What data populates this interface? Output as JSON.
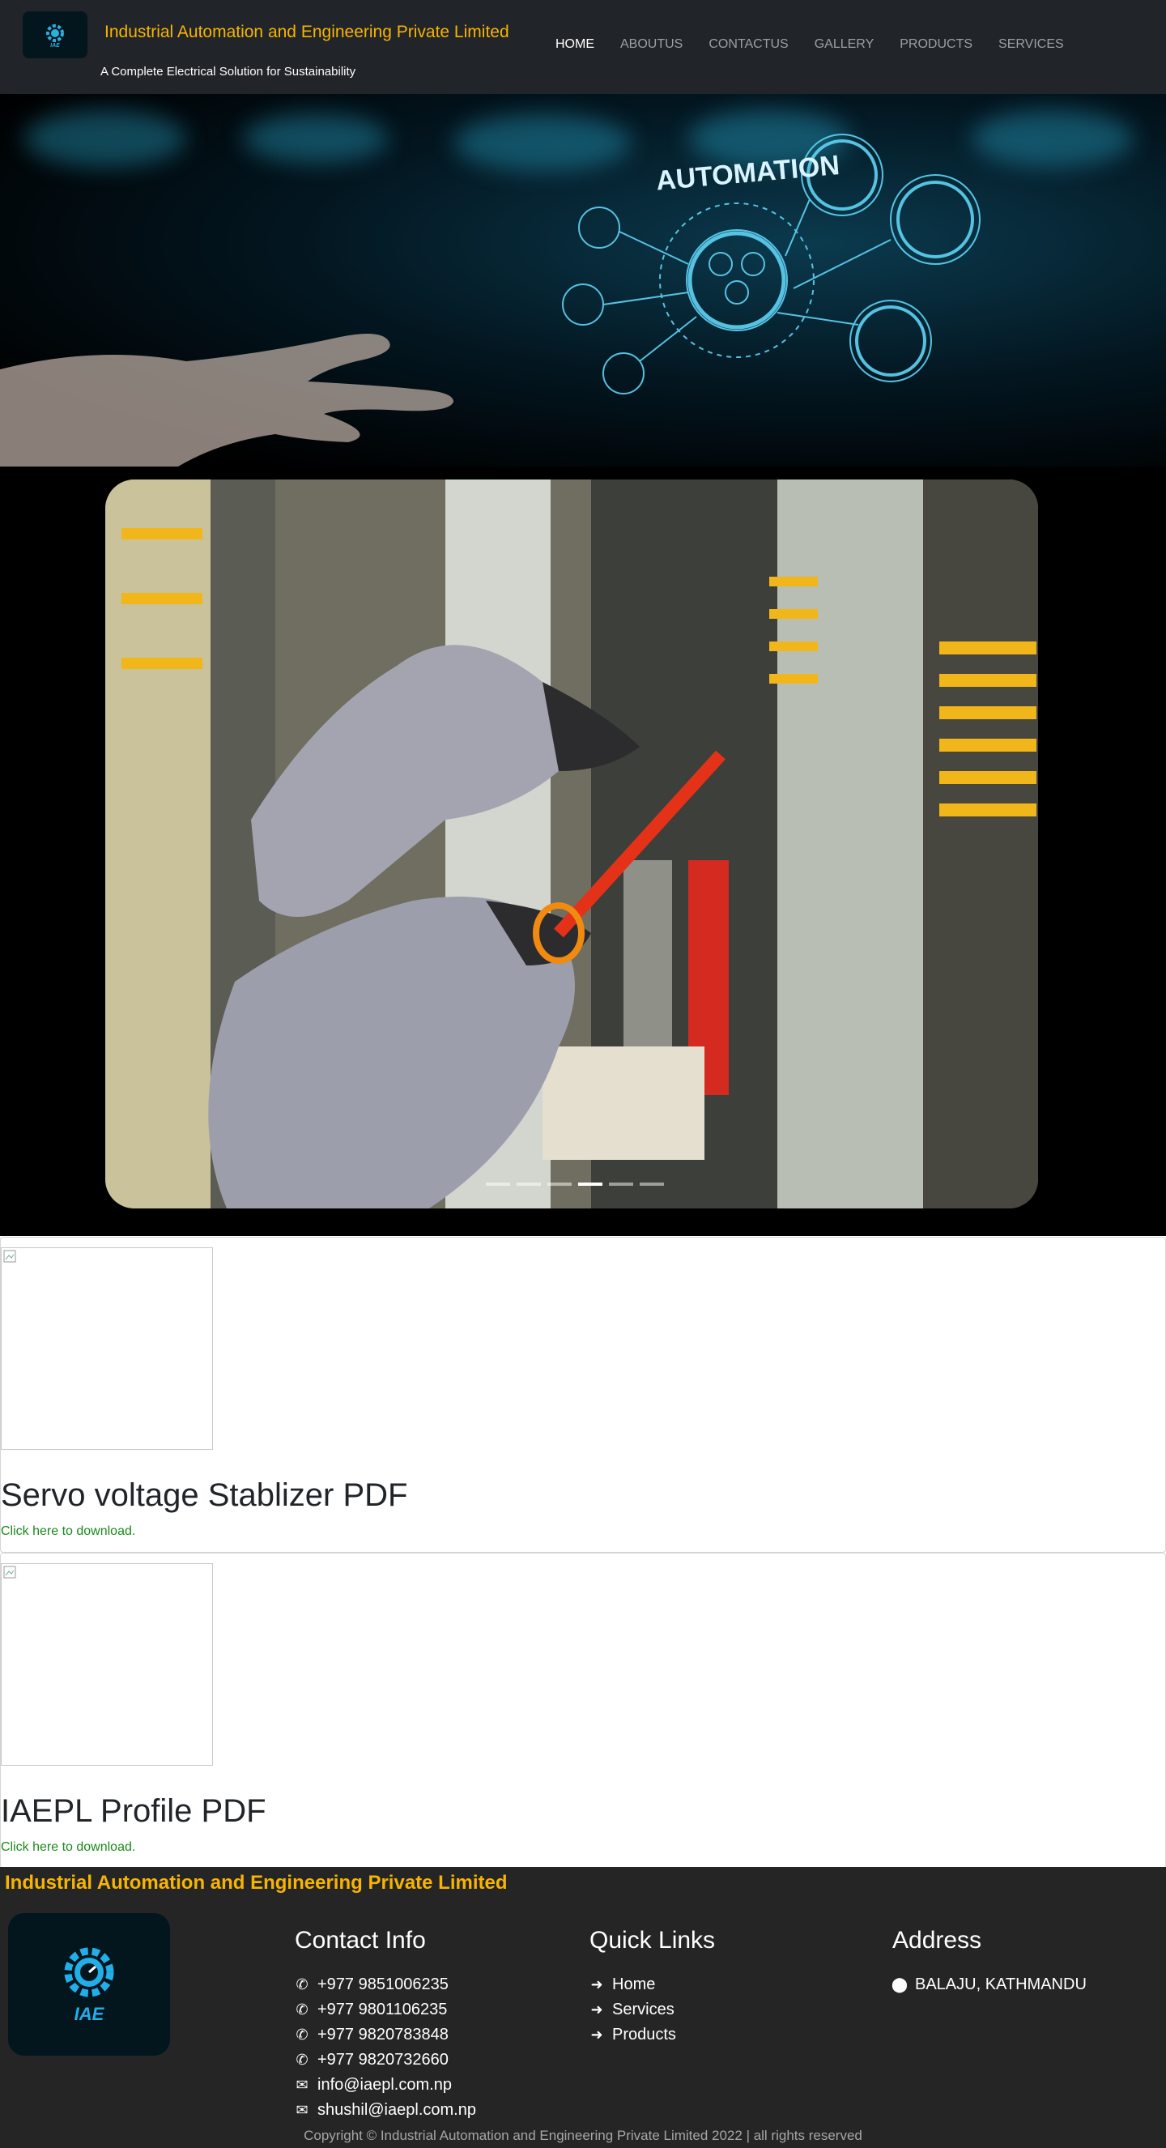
{
  "header": {
    "brand": "Industrial Automation and Engineering Private Limited",
    "tagline": "A Complete Electrical Solution for Sustainability",
    "nav": [
      {
        "label": "HOME",
        "active": true
      },
      {
        "label": "ABOUTUS",
        "active": false
      },
      {
        "label": "CONTACTUS",
        "active": false
      },
      {
        "label": "GALLERY",
        "active": false
      },
      {
        "label": "PRODUCTS",
        "active": false
      },
      {
        "label": "SERVICES",
        "active": false
      }
    ]
  },
  "hero": {
    "heading": "AUTOMATION"
  },
  "carousel": {
    "slide_count": 6,
    "active_index": 3
  },
  "cards": [
    {
      "title": "Servo voltage Stablizer PDF",
      "link": "Click here to download."
    },
    {
      "title": "IAEPL Profile PDF",
      "link": "Click here to download."
    }
  ],
  "footer": {
    "brand": "Industrial Automation and Engineering Private Limited",
    "logo_text": "IAE",
    "contact": {
      "heading": "Contact Info",
      "phones": [
        "+977 9851006235",
        "+977 9801106235",
        "+977 9820783848",
        "+977 9820732660"
      ],
      "emails": [
        "info@iaepl.com.np",
        "shushil@iaepl.com.np"
      ]
    },
    "quick_links": {
      "heading": "Quick Links",
      "items": [
        "Home",
        "Services",
        "Products"
      ]
    },
    "address": {
      "heading": "Address",
      "value": "BALAJU, KATHMANDU"
    },
    "copyright": "Copyright © Industrial Automation and Engineering Private Limited 2022 | all rights reserved"
  },
  "colors": {
    "brand": "#f7b400",
    "navbar": "#212429",
    "footer": "#252525",
    "link": "#1a8a1a"
  }
}
